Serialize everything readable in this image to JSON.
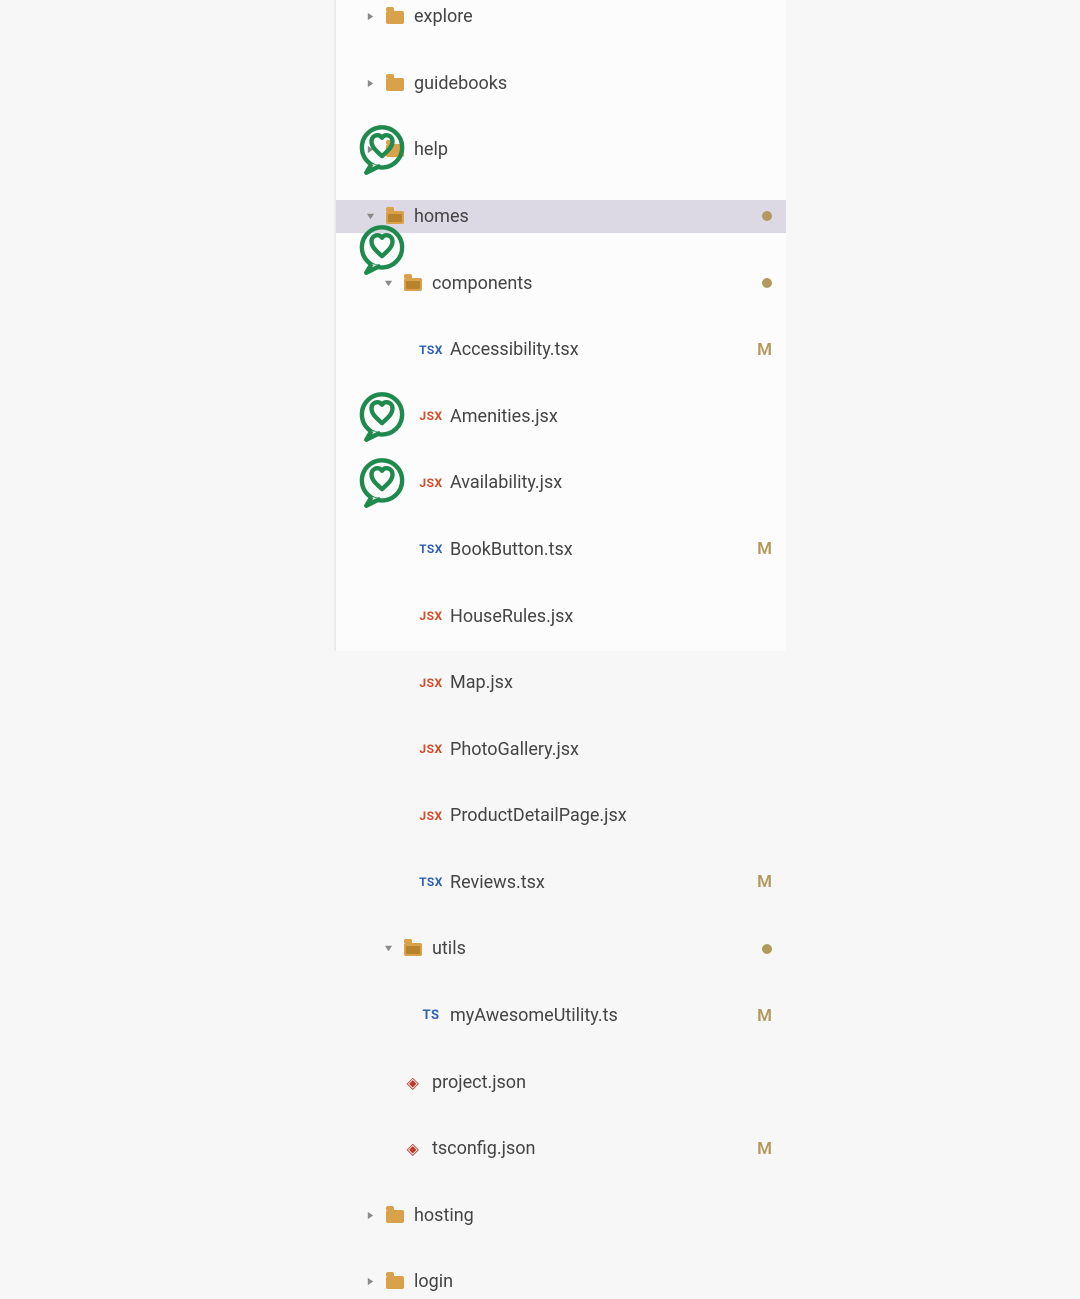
{
  "rows": [
    {
      "depth": 0,
      "chev": "right",
      "icon": "folder",
      "label": "explore"
    },
    {
      "depth": 0,
      "chev": "right",
      "icon": "folder",
      "label": "guidebooks"
    },
    {
      "depth": 0,
      "chev": "right",
      "icon": "folder",
      "label": "help"
    },
    {
      "depth": 0,
      "chev": "down",
      "icon": "folder-open",
      "label": "homes",
      "status": "dot",
      "selected": true
    },
    {
      "depth": 1,
      "chev": "down",
      "icon": "folder-open",
      "label": "components",
      "status": "dot",
      "heart": true
    },
    {
      "depth": 2,
      "icon": "tsx",
      "label": "Accessibility.tsx",
      "status": "M"
    },
    {
      "depth": 2,
      "icon": "jsx",
      "label": "Amenities.jsx"
    },
    {
      "depth": 2,
      "icon": "jsx",
      "label": "Availability.jsx",
      "heart": true
    },
    {
      "depth": 2,
      "icon": "tsx",
      "label": "BookButton.tsx",
      "status": "M"
    },
    {
      "depth": 2,
      "icon": "jsx",
      "label": "HouseRules.jsx"
    },
    {
      "depth": 2,
      "icon": "jsx",
      "label": "Map.jsx"
    },
    {
      "depth": 2,
      "icon": "jsx",
      "label": "PhotoGallery.jsx"
    },
    {
      "depth": 2,
      "icon": "jsx",
      "label": "ProductDetailPage.jsx",
      "heart": true
    },
    {
      "depth": 2,
      "icon": "tsx",
      "label": "Reviews.tsx",
      "status": "M"
    },
    {
      "depth": 1,
      "chev": "down",
      "icon": "folder-open",
      "label": "utils",
      "status": "dot",
      "heart": true
    },
    {
      "depth": 2,
      "icon": "ts",
      "label": "myAwesomeUtility.ts",
      "status": "M"
    },
    {
      "depth": 1,
      "icon": "json",
      "label": "project.json"
    },
    {
      "depth": 1,
      "icon": "json",
      "label": "tsconfig.json",
      "status": "M"
    },
    {
      "depth": 0,
      "chev": "right",
      "icon": "folder",
      "label": "hosting"
    },
    {
      "depth": 0,
      "chev": "right",
      "icon": "folder",
      "label": "login"
    }
  ],
  "indent": {
    "base": 48,
    "step": 18
  },
  "offsets": {
    "chev": -20,
    "icon": 0,
    "label": 30
  }
}
